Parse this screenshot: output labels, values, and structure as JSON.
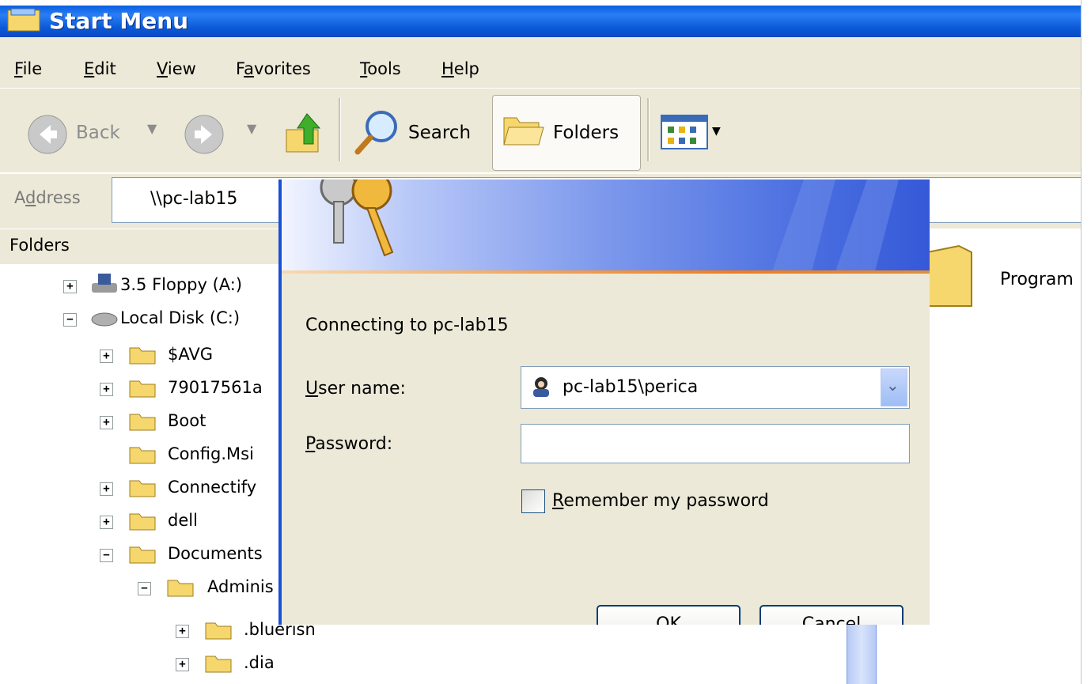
{
  "window": {
    "title": "Start Menu"
  },
  "menu": {
    "items": [
      "File",
      "Edit",
      "View",
      "Favorites",
      "Tools",
      "Help"
    ]
  },
  "toolbar": {
    "back_label": "Back",
    "search_label": "Search",
    "folders_label": "Folders"
  },
  "address": {
    "label": "Address",
    "value": "\\\\pc-lab15"
  },
  "folders_pane": {
    "header": "Folders",
    "items": [
      {
        "label": "3.5 Floppy (A:)",
        "expander": "+"
      },
      {
        "label": "Local Disk (C:)",
        "expander": "−"
      },
      {
        "label": "$AVG",
        "expander": "+"
      },
      {
        "label": "79017561a",
        "expander": "+"
      },
      {
        "label": "Boot",
        "expander": "+"
      },
      {
        "label": "Config.Msi",
        "expander": ""
      },
      {
        "label": "Connectify",
        "expander": "+"
      },
      {
        "label": "dell",
        "expander": "+"
      },
      {
        "label": "Documents",
        "expander": "−"
      },
      {
        "label": "Adminis",
        "expander": "−"
      },
      {
        "label": ".bluerisn",
        "expander": "+"
      },
      {
        "label": ".dia",
        "expander": "+"
      }
    ]
  },
  "right_pane": {
    "item_label": "Program"
  },
  "dialog": {
    "connecting_text": "Connecting to pc-lab15",
    "username_label": "User name:",
    "username_value": "pc-lab15\\perica",
    "password_label": "Password:",
    "password_value": "",
    "remember_label": "Remember my password",
    "remember_checked": false,
    "ok_label": "OK",
    "cancel_label": "Cancel"
  },
  "colors": {
    "titlebar": "#0a5fe0",
    "dialog_border": "#1a4fd6",
    "chrome": "#ece9d8"
  }
}
